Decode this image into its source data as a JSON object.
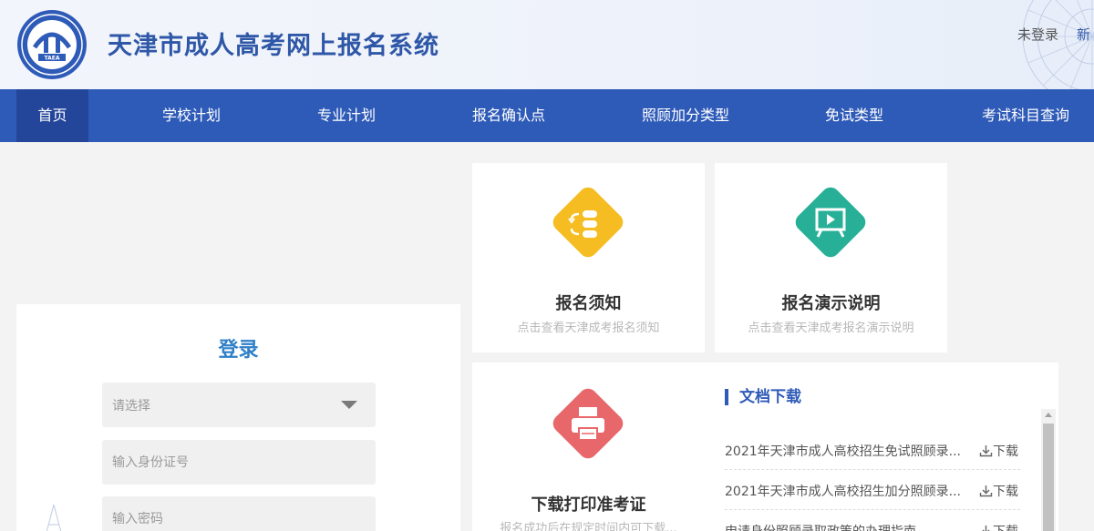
{
  "header": {
    "title": "天津市成人高考网上报名系统",
    "logo_text": "TAEA",
    "login_status": "未登录",
    "new_link": "新"
  },
  "nav": {
    "items": [
      "首页",
      "学校计划",
      "专业计划",
      "报名确认点",
      "照顾加分类型",
      "免试类型",
      "考试科目查询"
    ],
    "active": "首页"
  },
  "login": {
    "title": "登录",
    "select_placeholder": "请选择",
    "id_placeholder": "输入身份证号",
    "password_placeholder": "输入密码"
  },
  "cards": {
    "notice": {
      "title": "报名须知",
      "subtitle": "点击查看天津成考报名须知",
      "icon": "flow-icon",
      "color": "#f5bd22"
    },
    "demo": {
      "title": "报名演示说明",
      "subtitle": "点击查看天津成考报名演示说明",
      "icon": "presentation-icon",
      "color": "#27b097"
    },
    "print": {
      "title": "下载打印准考证",
      "subtitle": "报名成功后在规定时间内可下载...",
      "icon": "printer-icon",
      "color": "#e8676a"
    }
  },
  "downloads": {
    "title": "文档下载",
    "button_label": "下载",
    "items": [
      "2021年天津市成人高校招生免试照顾录...",
      "2021年天津市成人高校招生加分照顾录...",
      "申请身份照顾录取政策的办理指南"
    ]
  },
  "colors": {
    "brand_blue": "#2f5bb8",
    "nav_active": "#24469a",
    "login_title": "#2f80c8"
  }
}
